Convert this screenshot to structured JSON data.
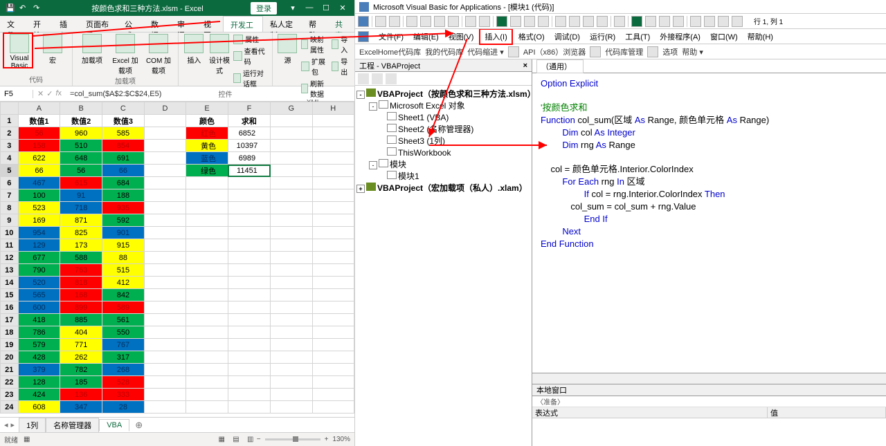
{
  "excel": {
    "title_filename": "按颜色求和三种方法.xlsm - Excel",
    "login": "登录",
    "ribbon_tabs": [
      "文件",
      "开始",
      "插入",
      "页面布局",
      "公式",
      "数据",
      "审阅",
      "视图",
      "开发工具",
      "私人定制",
      "帮助"
    ],
    "share": "共享",
    "ribbon_groups": {
      "code": {
        "visual_basic": "Visual Basic",
        "macros": "宏",
        "group": "代码"
      },
      "addins": {
        "addins": "加载项",
        "excel_add": "Excel 加载项",
        "com_add": "COM 加载项",
        "group": "加载项"
      },
      "controls": {
        "insert": "插入",
        "design": "设计模式",
        "props": "属性",
        "view_code": "查看代码",
        "run_dialog": "运行对话框",
        "group": "控件"
      },
      "xml": {
        "source": "源",
        "map_props": "映射属性",
        "expand": "扩展包",
        "refresh": "刷新数据",
        "import": "导入",
        "export": "导出",
        "group": "XML"
      }
    },
    "name_box": "F5",
    "formula": "=col_sum($A$2:$C$24,E5)",
    "columns": [
      "A",
      "B",
      "C",
      "D",
      "E",
      "F",
      "G",
      "H"
    ],
    "headers": {
      "v1": "数值1",
      "v2": "数值2",
      "v3": "数值3",
      "color": "颜色",
      "sum": "求和"
    },
    "data_rows": [
      {
        "r": 2,
        "c1": {
          "v": 56,
          "col": "red"
        },
        "c2": {
          "v": 960,
          "col": "yellow"
        },
        "c3": {
          "v": 585,
          "col": "yellow"
        },
        "label": "红色",
        "lcol": "red",
        "sum": 6852
      },
      {
        "r": 3,
        "c1": {
          "v": 158,
          "col": "red"
        },
        "c2": {
          "v": 510,
          "col": "green"
        },
        "c3": {
          "v": 854,
          "col": "red"
        },
        "label": "黄色",
        "lcol": "yellow",
        "sum": 10397
      },
      {
        "r": 4,
        "c1": {
          "v": 622,
          "col": "yellow"
        },
        "c2": {
          "v": 648,
          "col": "green"
        },
        "c3": {
          "v": 691,
          "col": "green"
        },
        "label": "蓝色",
        "lcol": "blue",
        "sum": 6989
      },
      {
        "r": 5,
        "c1": {
          "v": 66,
          "col": "yellow"
        },
        "c2": {
          "v": 56,
          "col": "green"
        },
        "c3": {
          "v": 66,
          "col": "blue"
        },
        "label": "绿色",
        "lcol": "green",
        "sum": 11451
      },
      {
        "r": 6,
        "c1": {
          "v": 467,
          "col": "blue"
        },
        "c2": {
          "v": 615,
          "col": "red"
        },
        "c3": {
          "v": 684,
          "col": "green"
        }
      },
      {
        "r": 7,
        "c1": {
          "v": 100,
          "col": "green"
        },
        "c2": {
          "v": 91,
          "col": "blue"
        },
        "c3": {
          "v": 188,
          "col": "green"
        }
      },
      {
        "r": 8,
        "c1": {
          "v": 523,
          "col": "yellow"
        },
        "c2": {
          "v": 718,
          "col": "blue"
        },
        "c3": {
          "v": 935,
          "col": "red"
        }
      },
      {
        "r": 9,
        "c1": {
          "v": 169,
          "col": "yellow"
        },
        "c2": {
          "v": 871,
          "col": "yellow"
        },
        "c3": {
          "v": 592,
          "col": "green"
        }
      },
      {
        "r": 10,
        "c1": {
          "v": 954,
          "col": "blue"
        },
        "c2": {
          "v": 825,
          "col": "yellow"
        },
        "c3": {
          "v": 901,
          "col": "blue"
        }
      },
      {
        "r": 11,
        "c1": {
          "v": 129,
          "col": "blue"
        },
        "c2": {
          "v": 173,
          "col": "yellow"
        },
        "c3": {
          "v": 915,
          "col": "yellow"
        }
      },
      {
        "r": 12,
        "c1": {
          "v": 677,
          "col": "green"
        },
        "c2": {
          "v": 588,
          "col": "green"
        },
        "c3": {
          "v": 88,
          "col": "yellow"
        }
      },
      {
        "r": 13,
        "c1": {
          "v": 790,
          "col": "green"
        },
        "c2": {
          "v": 763,
          "col": "red"
        },
        "c3": {
          "v": 515,
          "col": "yellow"
        }
      },
      {
        "r": 14,
        "c1": {
          "v": 520,
          "col": "blue"
        },
        "c2": {
          "v": 818,
          "col": "red"
        },
        "c3": {
          "v": 412,
          "col": "yellow"
        }
      },
      {
        "r": 15,
        "c1": {
          "v": 565,
          "col": "blue"
        },
        "c2": {
          "v": 168,
          "col": "red"
        },
        "c3": {
          "v": 842,
          "col": "green"
        }
      },
      {
        "r": 16,
        "c1": {
          "v": 600,
          "col": "blue"
        },
        "c2": {
          "v": 899,
          "col": "red"
        },
        "c3": {
          "v": 589,
          "col": "red"
        }
      },
      {
        "r": 17,
        "c1": {
          "v": 418,
          "col": "green"
        },
        "c2": {
          "v": 885,
          "col": "green"
        },
        "c3": {
          "v": 561,
          "col": "green"
        }
      },
      {
        "r": 18,
        "c1": {
          "v": 786,
          "col": "green"
        },
        "c2": {
          "v": 404,
          "col": "yellow"
        },
        "c3": {
          "v": 550,
          "col": "green"
        }
      },
      {
        "r": 19,
        "c1": {
          "v": 579,
          "col": "green"
        },
        "c2": {
          "v": 771,
          "col": "yellow"
        },
        "c3": {
          "v": 767,
          "col": "blue"
        }
      },
      {
        "r": 20,
        "c1": {
          "v": 428,
          "col": "green"
        },
        "c2": {
          "v": 262,
          "col": "yellow"
        },
        "c3": {
          "v": 317,
          "col": "green"
        }
      },
      {
        "r": 21,
        "c1": {
          "v": 379,
          "col": "blue"
        },
        "c2": {
          "v": 782,
          "col": "green"
        },
        "c3": {
          "v": 268,
          "col": "blue"
        }
      },
      {
        "r": 22,
        "c1": {
          "v": 128,
          "col": "green"
        },
        "c2": {
          "v": 185,
          "col": "green"
        },
        "c3": {
          "v": 528,
          "col": "red"
        }
      },
      {
        "r": 23,
        "c1": {
          "v": 424,
          "col": "green"
        },
        "c2": {
          "v": 136,
          "col": "red"
        },
        "c3": {
          "v": 333,
          "col": "red"
        }
      },
      {
        "r": 24,
        "c1": {
          "v": 608,
          "col": "yellow"
        },
        "c2": {
          "v": 347,
          "col": "blue"
        },
        "c3": {
          "v": 28,
          "col": "blue"
        }
      }
    ],
    "sheet_tabs": [
      "1列",
      "名称管理器",
      "VBA"
    ],
    "status_ready": "就绪",
    "status_auto": "",
    "zoom": "130%"
  },
  "vbe": {
    "title": "Microsoft Visual Basic for Applications - [模块1 (代码)]",
    "pos": "行 1, 列 1",
    "menus": [
      "文件(F)",
      "编辑(E)",
      "视图(V)",
      "插入(I)",
      "格式(O)",
      "调试(D)",
      "运行(R)",
      "工具(T)",
      "外接程序(A)",
      "窗口(W)",
      "帮助(H)"
    ],
    "toolbar2": [
      "ExcelHome代码库",
      "我的代码库",
      "代码缩进 ▾",
      "API（x86）浏览器",
      "代码库管理",
      "选项",
      "帮助 ▾"
    ],
    "project_title": "工程 - VBAProject",
    "tree": {
      "p1": "VBAProject（按颜色求和三种方法.xlsm）",
      "folder1": "Microsoft Excel 对象",
      "s1": "Sheet1 (VBA)",
      "s2": "Sheet2 (名称管理器)",
      "s3": "Sheet3 (1列)",
      "s4": "ThisWorkbook",
      "folder2": "模块",
      "m1": "模块1",
      "p2": "VBAProject（宏加载项（私人）.xlam）"
    },
    "code_dropdown": "（通用）",
    "code": {
      "l1": "Option Explicit",
      "l2": "'按颜色求和",
      "l3a": "Function",
      "l3b": " col_sum(区域 ",
      "l3c": "As",
      "l3d": " Range, 颜色单元格 ",
      "l3e": "As",
      "l3f": " Range)",
      "l4a": "Dim",
      "l4b": " col ",
      "l4c": "As Integer",
      "l5a": "Dim",
      "l5b": " rng ",
      "l5c": "As",
      "l5d": " Range",
      "l6": "    col = 颜色单元格.Interior.ColorIndex",
      "l7a": "For Each",
      "l7b": " rng ",
      "l7c": "In",
      "l7d": " 区域",
      "l8a": "If",
      "l8b": " col = rng.Interior.ColorIndex ",
      "l8c": "Then",
      "l9": "            col_sum = col_sum + rng.Value",
      "l10": "End If",
      "l11": "Next",
      "l12": "End Function"
    },
    "locals_title": "本地窗口",
    "locals_ready": "〈准备〉",
    "locals_cols": {
      "expr": "表达式",
      "val": "值"
    }
  }
}
